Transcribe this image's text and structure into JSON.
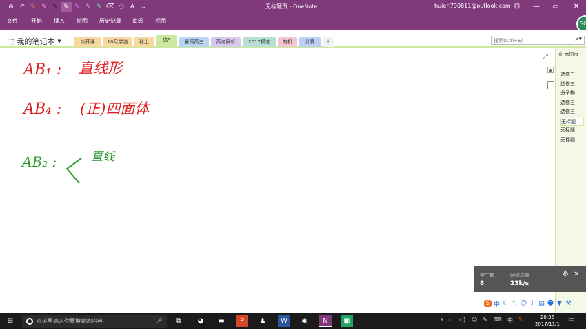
{
  "window": {
    "title": "无标题页 - OneNote",
    "user": "huierl790811@outlook.com"
  },
  "quick_access": [
    "back-icon",
    "undo-icon",
    "pen-red-icon",
    "pen-pink-icon",
    "pen-black-icon",
    "pen-white-icon",
    "pen-purple-icon",
    "pen-purple2-icon",
    "pen-green-icon",
    "eraser-icon",
    "lasso-icon",
    "type-icon",
    "more-icon"
  ],
  "ribbon_tabs": [
    "文件",
    "开始",
    "插入",
    "绘图",
    "历史记录",
    "审阅",
    "视图"
  ],
  "avatar_text": "SG",
  "notebook": {
    "name": "我的笔记本"
  },
  "sections": [
    {
      "label": "公开课",
      "color": "#f7d8a0"
    },
    {
      "label": "10月学道",
      "color": "#f7d8a0"
    },
    {
      "label": "秋上",
      "color": "#f7d8a0"
    },
    {
      "label": "选3",
      "color": "#cfe8a0"
    },
    {
      "label": "暑假高三",
      "color": "#b8d6f2"
    },
    {
      "label": "高考解析",
      "color": "#d9c8f0"
    },
    {
      "label": "2017模考",
      "color": "#b8e0d8"
    },
    {
      "label": "有机",
      "color": "#f3c6d4"
    },
    {
      "label": "计算",
      "color": "#bcd0f5"
    },
    {
      "label": "+",
      "color": "#f2f2f2"
    }
  ],
  "search": {
    "placeholder": "搜索(Ctrl+E)"
  },
  "pages": {
    "add_label": "添加页",
    "items": [
      "选修三",
      "选修三",
      "分子构",
      "选修三",
      "选修三",
      "无标题",
      "无标题",
      "无标题"
    ]
  },
  "ink": {
    "line1": {
      "label": "AB₁ :",
      "text": "直线形",
      "color": "#e02020"
    },
    "line2": {
      "label": "AB₄ :",
      "text": "(正)四面体",
      "color": "#e02020"
    },
    "line3": {
      "label": "AB₂ :",
      "text": "直线",
      "color": "#2e9a2e"
    }
  },
  "widget": {
    "students_label": "学生数",
    "students_value": "8",
    "network_label": "网络质量",
    "network_value": "23k/s"
  },
  "taskbar": {
    "search_placeholder": "在这里输入你要搜索的内容",
    "time": "20:36",
    "date": "2017/11/1",
    "ime": "中"
  }
}
